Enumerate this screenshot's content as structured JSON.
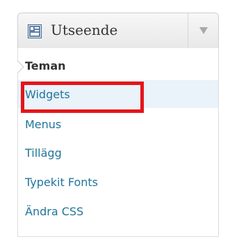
{
  "menu": {
    "title": "Utseende",
    "icon": "appearance-icon",
    "toggle_icon": "triangle-down-icon",
    "items": [
      {
        "label": "Teman",
        "state": "current"
      },
      {
        "label": "Widgets",
        "state": "highlighted"
      },
      {
        "label": "Menus"
      },
      {
        "label": "Tillägg"
      },
      {
        "label": "Typekit Fonts"
      },
      {
        "label": "Ändra CSS"
      }
    ]
  },
  "annotation": {
    "color": "#e3151a"
  },
  "colors": {
    "link": "#21759b",
    "current": "#333333",
    "hover_bg": "#eaf2fa"
  }
}
